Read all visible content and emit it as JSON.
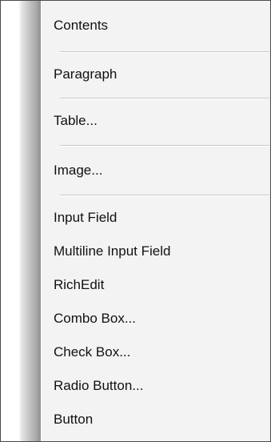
{
  "menu": {
    "items": [
      {
        "label": "Contents"
      },
      {
        "label": "Paragraph"
      },
      {
        "label": "Table..."
      },
      {
        "label": "Image..."
      },
      {
        "label": "Input Field"
      },
      {
        "label": "Multiline Input Field"
      },
      {
        "label": "RichEdit"
      },
      {
        "label": "Combo Box..."
      },
      {
        "label": "Check Box..."
      },
      {
        "label": "Radio Button..."
      },
      {
        "label": "Button"
      }
    ]
  }
}
